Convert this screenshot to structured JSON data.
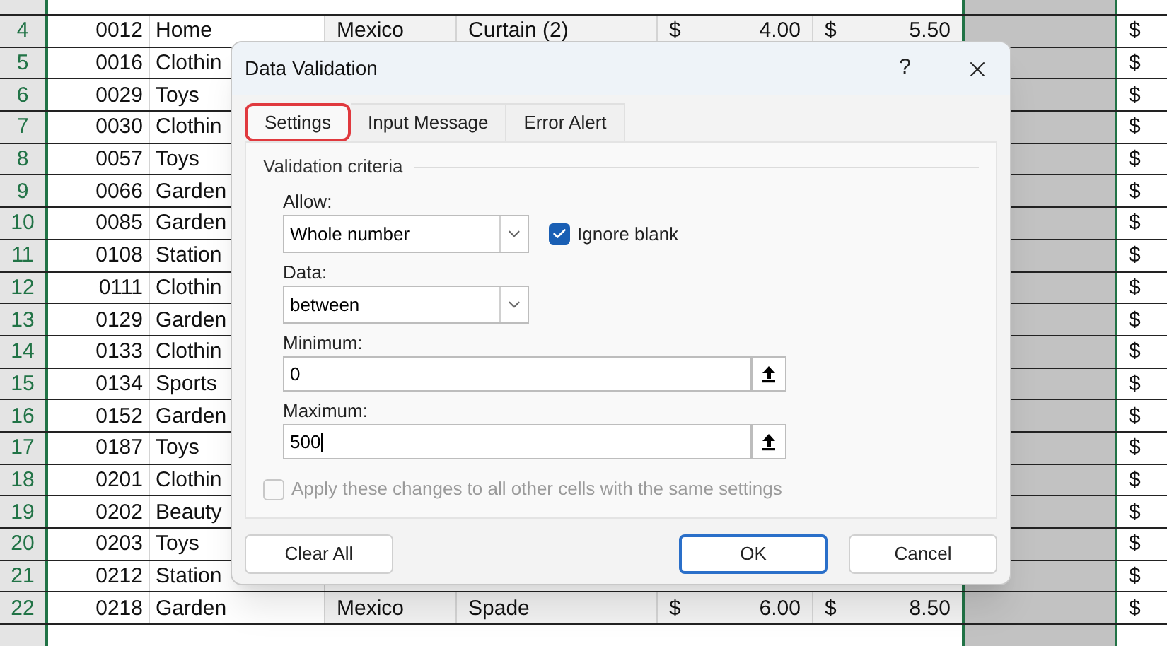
{
  "sheet": {
    "rows": [
      {
        "row_number": "4",
        "id": "0012",
        "category": "Home",
        "country": "Mexico",
        "item": "Curtain (2)",
        "price_symbol": "$",
        "price": "4.00",
        "cost_symbol": "$",
        "cost": "5.50",
        "column_h": "$"
      },
      {
        "row_number": "5",
        "id": "0016",
        "category": "Clothin",
        "column_h": "$"
      },
      {
        "row_number": "6",
        "id": "0029",
        "category": "Toys",
        "column_h": "$"
      },
      {
        "row_number": "7",
        "id": "0030",
        "category": "Clothin",
        "column_h": "$"
      },
      {
        "row_number": "8",
        "id": "0057",
        "category": "Toys",
        "column_h": "$"
      },
      {
        "row_number": "9",
        "id": "0066",
        "category": "Garden",
        "column_h": "$"
      },
      {
        "row_number": "10",
        "id": "0085",
        "category": "Garden",
        "column_h": "$"
      },
      {
        "row_number": "11",
        "id": "0108",
        "category": "Station",
        "column_h": "$"
      },
      {
        "row_number": "12",
        "id": "0111",
        "category": "Clothin",
        "column_h": "$"
      },
      {
        "row_number": "13",
        "id": "0129",
        "category": "Garden",
        "column_h": "$"
      },
      {
        "row_number": "14",
        "id": "0133",
        "category": "Clothin",
        "column_h": "$"
      },
      {
        "row_number": "15",
        "id": "0134",
        "category": "Sports",
        "column_h": "$"
      },
      {
        "row_number": "16",
        "id": "0152",
        "category": "Garden",
        "column_h": "$"
      },
      {
        "row_number": "17",
        "id": "0187",
        "category": "Toys",
        "column_h": "$"
      },
      {
        "row_number": "18",
        "id": "0201",
        "category": "Clothin",
        "column_h": "$"
      },
      {
        "row_number": "19",
        "id": "0202",
        "category": "Beauty",
        "column_h": "$"
      },
      {
        "row_number": "20",
        "id": "0203",
        "category": "Toys",
        "column_h": "$"
      },
      {
        "row_number": "21",
        "id": "0212",
        "category": "Station",
        "column_h": "$"
      },
      {
        "row_number": "22",
        "id": "0218",
        "category": "Garden",
        "country": "Mexico",
        "item": "Spade",
        "price_symbol": "$",
        "price": "6.00",
        "cost_symbol": "$",
        "cost": "8.50",
        "column_h": "$"
      }
    ]
  },
  "dialog": {
    "title": "Data Validation",
    "help": "?",
    "tabs": [
      {
        "label": "Settings",
        "selected": true
      },
      {
        "label": "Input Message",
        "selected": false
      },
      {
        "label": "Error Alert",
        "selected": false
      }
    ],
    "section": "Validation criteria",
    "allow": {
      "label": "Allow:",
      "value": "Whole number"
    },
    "ignore_blank": {
      "label": "Ignore blank",
      "checked": true
    },
    "data": {
      "label": "Data:",
      "value": "between"
    },
    "minimum": {
      "label": "Minimum:",
      "value": "0"
    },
    "maximum": {
      "label": "Maximum:",
      "value": "500"
    },
    "apply_all": {
      "label": "Apply these changes to all other cells with the same settings",
      "checked": false,
      "disabled": true
    },
    "buttons": [
      {
        "label": "Clear All",
        "kind": "plain"
      },
      {
        "label": "OK",
        "kind": "default"
      },
      {
        "label": "Cancel",
        "kind": "plain"
      }
    ]
  }
}
